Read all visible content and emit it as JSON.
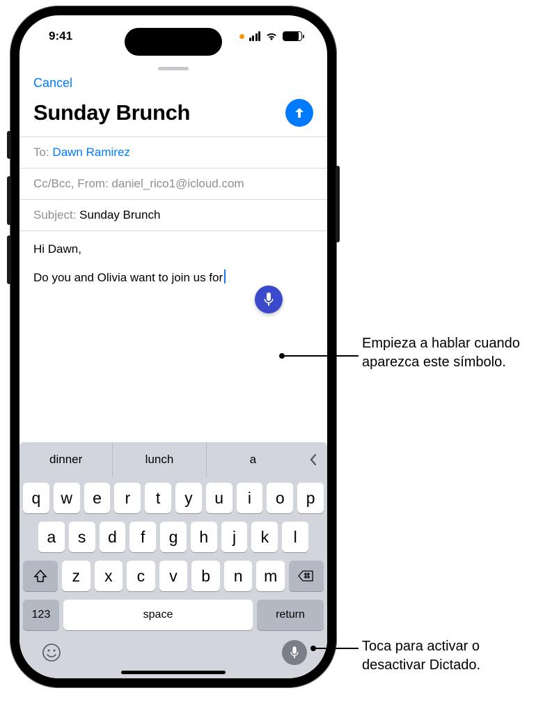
{
  "status": {
    "time": "9:41"
  },
  "compose": {
    "cancel": "Cancel",
    "title": "Sunday Brunch",
    "to_label": "To:",
    "to_value": "Dawn Ramirez",
    "cc_label": "Cc/Bcc, From:",
    "cc_value": "daniel_rico1@icloud.com",
    "subject_label": "Subject:",
    "subject_value": "Sunday Brunch",
    "body_line1": "Hi Dawn,",
    "body_line2": "Do you and Olivia want to join us for"
  },
  "suggestions": [
    "dinner",
    "lunch",
    "a"
  ],
  "keyboard": {
    "row1": [
      "q",
      "w",
      "e",
      "r",
      "t",
      "y",
      "u",
      "i",
      "o",
      "p"
    ],
    "row2": [
      "a",
      "s",
      "d",
      "f",
      "g",
      "h",
      "j",
      "k",
      "l"
    ],
    "row3": [
      "z",
      "x",
      "c",
      "v",
      "b",
      "n",
      "m"
    ],
    "num": "123",
    "space": "space",
    "return": "return"
  },
  "callouts": {
    "c1": "Empieza a hablar cuando aparezca este símbolo.",
    "c2": "Toca para activar o desactivar Dictado."
  }
}
